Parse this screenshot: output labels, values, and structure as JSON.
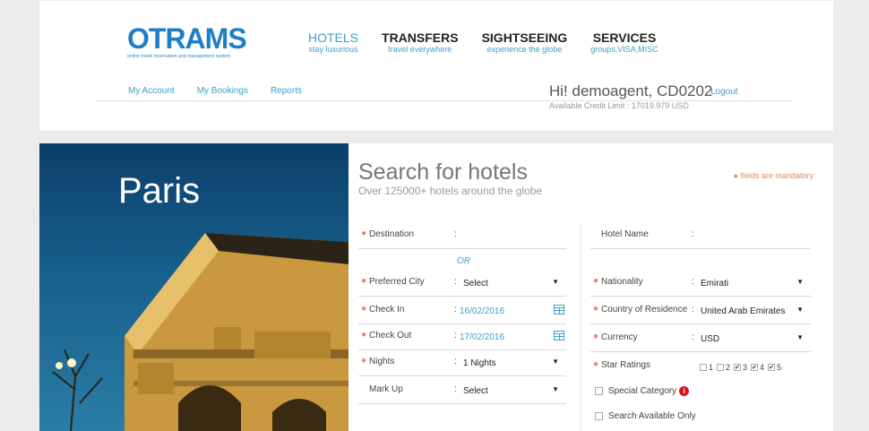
{
  "header": {
    "logo": {
      "word": "OTRAMS",
      "tagline": "online travel reservation and management system"
    },
    "nav": [
      {
        "title": "HOTELS",
        "sub": "stay luxurious"
      },
      {
        "title": "TRANSFERS",
        "sub": "travel everywhere"
      },
      {
        "title": "SIGHTSEEING",
        "sub": "experience the globe"
      },
      {
        "title": "SERVICES",
        "sub": "groups,VISA,MISC"
      }
    ],
    "links": [
      "My Account",
      "My Bookings",
      "Reports"
    ],
    "greeting": "Hi! demoagent, CD0202",
    "logout": "Logout",
    "credit": "Available Credit Limit : 17019.979 USD"
  },
  "hero": {
    "city": "Paris"
  },
  "form": {
    "title": "Search for hotels",
    "subtitle": "Over 125000+ hotels around the globe",
    "mandatory": "fields are mandatory",
    "or": "OR",
    "left": {
      "destination": {
        "label": "Destination",
        "value": ""
      },
      "preferred_city": {
        "label": "Preferred City",
        "value": "Select"
      },
      "check_in": {
        "label": "Check In",
        "value": "16/02/2016"
      },
      "check_out": {
        "label": "Check Out",
        "value": "17/02/2016"
      },
      "nights": {
        "label": "Nights",
        "value": "1 Nights"
      },
      "markup": {
        "label": "Mark Up",
        "value": "Select"
      }
    },
    "right": {
      "hotel_name": {
        "label": "Hotel Name",
        "value": ""
      },
      "nationality": {
        "label": "Nationality",
        "value": "Emirati"
      },
      "residence": {
        "label": "Country of Residence",
        "value": "United Arab Emirates"
      },
      "currency": {
        "label": "Currency",
        "value": "USD"
      },
      "star_ratings": {
        "label": "Star Ratings"
      }
    },
    "stars": [
      {
        "label": "1",
        "checked": false
      },
      {
        "label": "2",
        "checked": false
      },
      {
        "label": "3",
        "checked": true
      },
      {
        "label": "4",
        "checked": true
      },
      {
        "label": "5",
        "checked": true
      }
    ],
    "special_category": "Special Category",
    "search_available": "Search Available Only"
  },
  "colors": {
    "accent": "#3f9ec9",
    "mandatory": "#e8856f",
    "info": "#d9141c"
  },
  "icons": [
    "calendar-icon",
    "dropdown-arrow-icon",
    "info-icon"
  ]
}
